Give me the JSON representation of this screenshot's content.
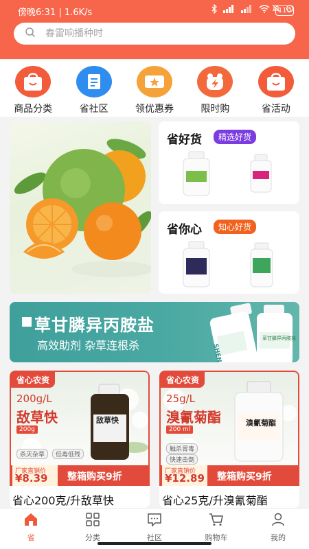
{
  "status_bar": {
    "time_text": "傍晚6:31 | 1.6K/s",
    "battery": "110"
  },
  "search": {
    "placeholder": "春雷响播种时"
  },
  "quick_nav": [
    {
      "label": "商品分类",
      "icon": "shopping-bag-icon"
    },
    {
      "label": "省社区",
      "icon": "document-icon"
    },
    {
      "label": "领优惠券",
      "icon": "coupon-icon"
    },
    {
      "label": "限时购",
      "icon": "flash-sale-icon"
    },
    {
      "label": "省活动",
      "icon": "activity-bag-icon"
    }
  ],
  "promo": {
    "card1": {
      "title": "省好货",
      "tag": "精选好货"
    },
    "card2": {
      "title": "省你心",
      "tag": "知心好货"
    }
  },
  "banner": {
    "title": "草甘膦异丙胺盐",
    "subtitle": "高效助剂 杂草连根杀",
    "bottle_labels": [
      "草甘膦异丙胺盐",
      "SHENG"
    ]
  },
  "products": [
    {
      "top_tag": "省心农资",
      "spec": "200g/L",
      "name_big": "敌草快",
      "volume": "200g",
      "bottle_label": "敌草快",
      "benefits": [
        "杀灭杂草",
        "低毒低残"
      ],
      "price_label": "厂家直销价",
      "price": "¥8.39",
      "promo": "整箱购买9折",
      "caption": "省心200克/升敌草快"
    },
    {
      "top_tag": "省心农资",
      "spec": "25g/L",
      "name_big": "溴氰菊酯",
      "volume": "200 ml",
      "bottle_label": "溴氰菊酯",
      "benefits": [
        "触杀胃毒",
        "快速击倒"
      ],
      "price_label": "厂家直销价",
      "price": "¥12.89",
      "promo": "整箱购买9折",
      "caption": "省心25克/升溴氰菊酯"
    }
  ],
  "tabbar": [
    {
      "label": "省",
      "icon": "home-icon",
      "active": true
    },
    {
      "label": "分类",
      "icon": "grid-icon",
      "active": false
    },
    {
      "label": "社区",
      "icon": "chat-icon",
      "active": false
    },
    {
      "label": "购物车",
      "icon": "cart-icon",
      "active": false
    },
    {
      "label": "我的",
      "icon": "user-icon",
      "active": false
    }
  ],
  "colors": {
    "brand": "#f7664a",
    "accent_red": "#e24b3b",
    "tag_purple": "#7c3de0",
    "tag_orange": "#f2611e",
    "banner_teal": "#4aa9a3"
  }
}
